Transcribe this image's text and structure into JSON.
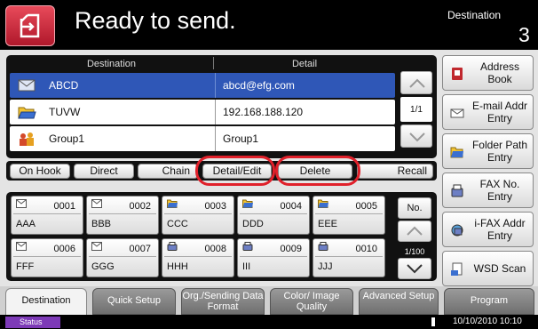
{
  "header": {
    "title": "Ready to send.",
    "destination_label": "Destination",
    "destination_count": "3"
  },
  "list": {
    "col_destination": "Destination",
    "col_detail": "Detail",
    "rows": [
      {
        "icon": "email-icon",
        "name": "ABCD",
        "detail": "abcd@efg.com",
        "selected": true
      },
      {
        "icon": "folder-icon",
        "name": "TUVW",
        "detail": "192.168.188.120",
        "selected": false
      },
      {
        "icon": "group-icon",
        "name": "Group1",
        "detail": "Group1",
        "selected": false
      }
    ],
    "page": "1/1"
  },
  "actions": {
    "on_hook": "On Hook",
    "direct": "Direct",
    "chain": "Chain",
    "detail_edit": "Detail/Edit",
    "delete": "Delete",
    "recall": "Recall"
  },
  "side": {
    "address_book": "Address Book",
    "email_addr_entry": "E-mail Addr Entry",
    "folder_path_entry": "Folder Path Entry",
    "fax_no_entry": "FAX No. Entry",
    "ifax_addr_entry": "i-FAX Addr Entry",
    "wsd_scan": "WSD Scan"
  },
  "keys": {
    "items": [
      {
        "num": "0001",
        "label": "AAA",
        "icon": "email-icon"
      },
      {
        "num": "0002",
        "label": "BBB",
        "icon": "email-icon"
      },
      {
        "num": "0003",
        "label": "CCC",
        "icon": "folder-icon"
      },
      {
        "num": "0004",
        "label": "DDD",
        "icon": "folder-icon"
      },
      {
        "num": "0005",
        "label": "EEE",
        "icon": "folder-icon"
      },
      {
        "num": "0006",
        "label": "FFF",
        "icon": "email-icon"
      },
      {
        "num": "0007",
        "label": "GGG",
        "icon": "email-icon"
      },
      {
        "num": "0008",
        "label": "HHH",
        "icon": "fax-icon"
      },
      {
        "num": "0009",
        "label": "III",
        "icon": "fax-icon"
      },
      {
        "num": "0010",
        "label": "JJJ",
        "icon": "fax-icon"
      }
    ],
    "no_label": "No.",
    "page": "1/100"
  },
  "tabs": [
    {
      "label": "Destination",
      "active": true
    },
    {
      "label": "Quick Setup",
      "active": false
    },
    {
      "label": "Org./Sending Data Format",
      "active": false
    },
    {
      "label": "Color/ Image Quality",
      "active": false
    },
    {
      "label": "Advanced Setup",
      "active": false
    },
    {
      "label": "Program",
      "active": false
    }
  ],
  "status": {
    "status_label": "Status",
    "datetime": "10/10/2010 10:10"
  },
  "colors": {
    "selected_row": "#2f57b7",
    "highlight_circle": "#e0202a",
    "home_button": "#c8243a",
    "status_button": "#7d3ab7"
  }
}
